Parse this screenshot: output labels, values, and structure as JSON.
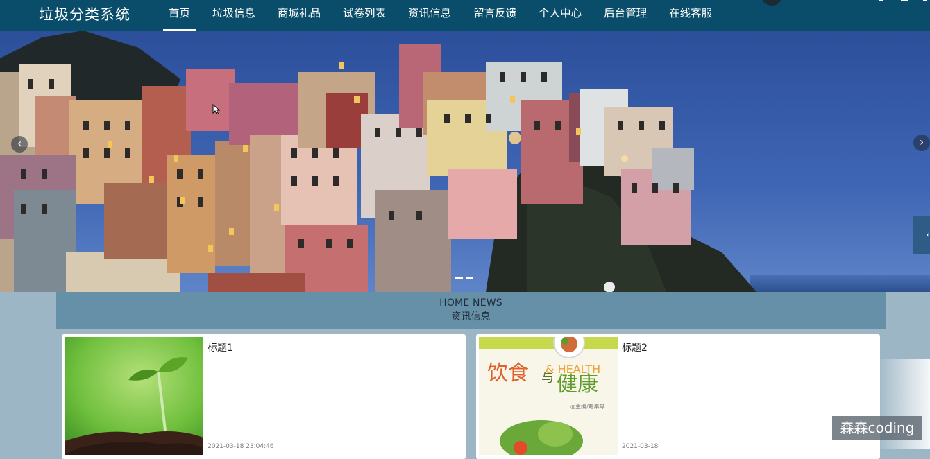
{
  "app": {
    "brand": "垃圾分类系统"
  },
  "nav": {
    "items": [
      {
        "label": "首页",
        "active": true
      },
      {
        "label": "垃圾信息",
        "active": false
      },
      {
        "label": "商城礼品",
        "active": false
      },
      {
        "label": "试卷列表",
        "active": false
      },
      {
        "label": "资讯信息",
        "active": false
      },
      {
        "label": "留言反馈",
        "active": false
      },
      {
        "label": "个人中心",
        "active": false
      },
      {
        "label": "后台管理",
        "active": false
      },
      {
        "label": "在线客服",
        "active": false
      }
    ]
  },
  "banner": {
    "prev_icon": "‹",
    "next_icon": "›",
    "side_tab_icon": "‹",
    "active_slide": 1,
    "slide_count": 3
  },
  "news": {
    "heading_en": "HOME NEWS",
    "heading_cn": "资讯信息",
    "items": [
      {
        "title": "标题1",
        "time": "2021-03-18 23:04:46",
        "thumb": "seedling-image"
      },
      {
        "title": "标题2",
        "time": "2021-03-18",
        "thumb": "book-cover-image",
        "cover_cn_a": "饮食",
        "cover_cn_b": "与",
        "cover_cn_c": "健康",
        "cover_en": "& HEALTH",
        "cover_author": "◎主编/鲍秦琴"
      }
    ]
  },
  "watermark": "森森coding",
  "colors": {
    "nav_bg": "#0a4d6b",
    "page_bg": "#9db6c5",
    "news_header_bg": "#6690a8",
    "side_tab_bg": "#2e5c86"
  }
}
